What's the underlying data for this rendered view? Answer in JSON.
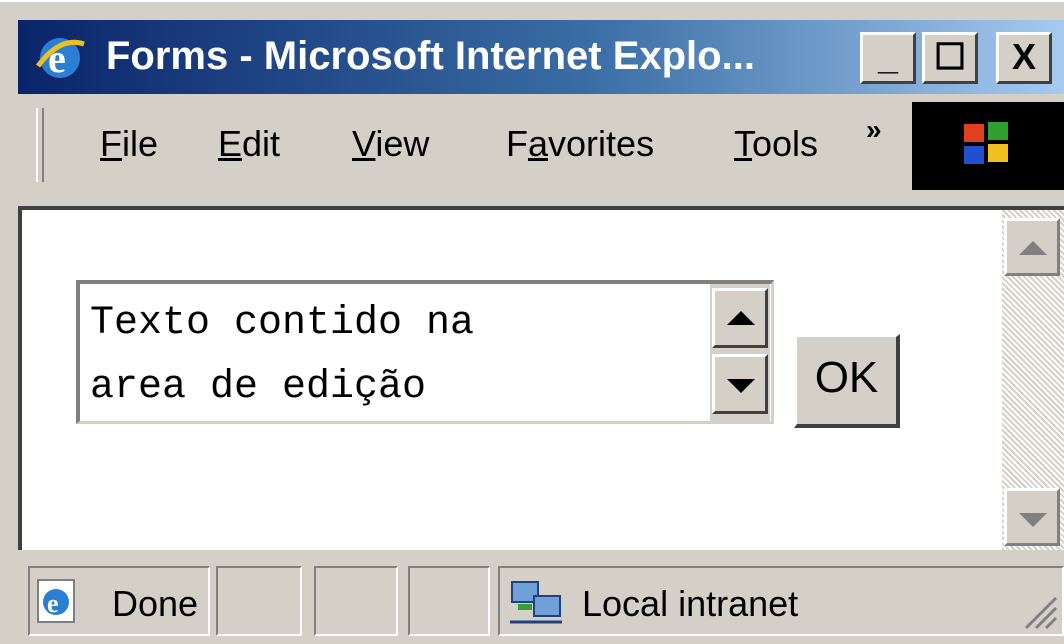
{
  "window": {
    "title": "Forms - Microsoft Internet Explo...",
    "controls": {
      "minimize": "_",
      "maximize": "☐",
      "close": "X"
    }
  },
  "menu": {
    "items": [
      {
        "label": "File",
        "accel_index": 0
      },
      {
        "label": "Edit",
        "accel_index": 0
      },
      {
        "label": "View",
        "accel_index": 0
      },
      {
        "label": "Favorites",
        "accel_index": 1
      },
      {
        "label": "Tools",
        "accel_index": 0
      }
    ],
    "overflow": "»"
  },
  "content": {
    "textarea_value": "Texto contido na\narea de edição",
    "ok_label": "OK"
  },
  "status": {
    "text": "Done",
    "zone": "Local intranet"
  },
  "colors": {
    "titlebar_start": "#0a246a",
    "titlebar_end": "#a6caf0",
    "face": "#d4d0c8"
  },
  "icons": {
    "title": "ie-icon",
    "logo": "windows-flag-logo",
    "status": "ie-page-icon",
    "zone": "network-computers-icon"
  }
}
